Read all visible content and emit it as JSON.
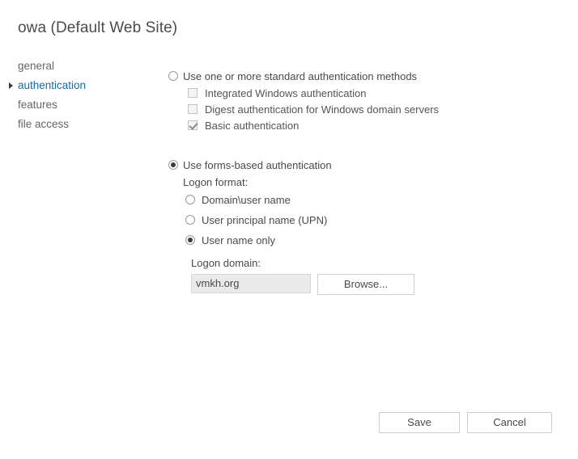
{
  "page": {
    "title": "owa (Default Web Site)"
  },
  "sidebar": {
    "items": [
      {
        "label": "general",
        "selected": false
      },
      {
        "label": "authentication",
        "selected": true
      },
      {
        "label": "features",
        "selected": false
      },
      {
        "label": "file access",
        "selected": false
      }
    ]
  },
  "main": {
    "standard_auth": {
      "label": "Use one or more standard authentication methods",
      "selected": false,
      "options": [
        {
          "label": "Integrated Windows authentication",
          "checked": false
        },
        {
          "label": "Digest authentication for Windows domain servers",
          "checked": false
        },
        {
          "label": "Basic authentication",
          "checked": true
        }
      ]
    },
    "forms_auth": {
      "label": "Use forms-based authentication",
      "selected": true,
      "logon_format_label": "Logon format:",
      "logon_formats": [
        {
          "label": "Domain\\user name",
          "selected": false
        },
        {
          "label": "User principal name (UPN)",
          "selected": false
        },
        {
          "label": "User name only",
          "selected": true
        }
      ],
      "logon_domain_label": "Logon domain:",
      "logon_domain_value": "vmkh.org",
      "logon_domain_placeholder": "",
      "browse_label": "Browse..."
    }
  },
  "footer": {
    "save_label": "Save",
    "cancel_label": "Cancel"
  },
  "colors": {
    "accent": "#176aa8",
    "text": "#4a4a4a",
    "muted": "#666666"
  }
}
